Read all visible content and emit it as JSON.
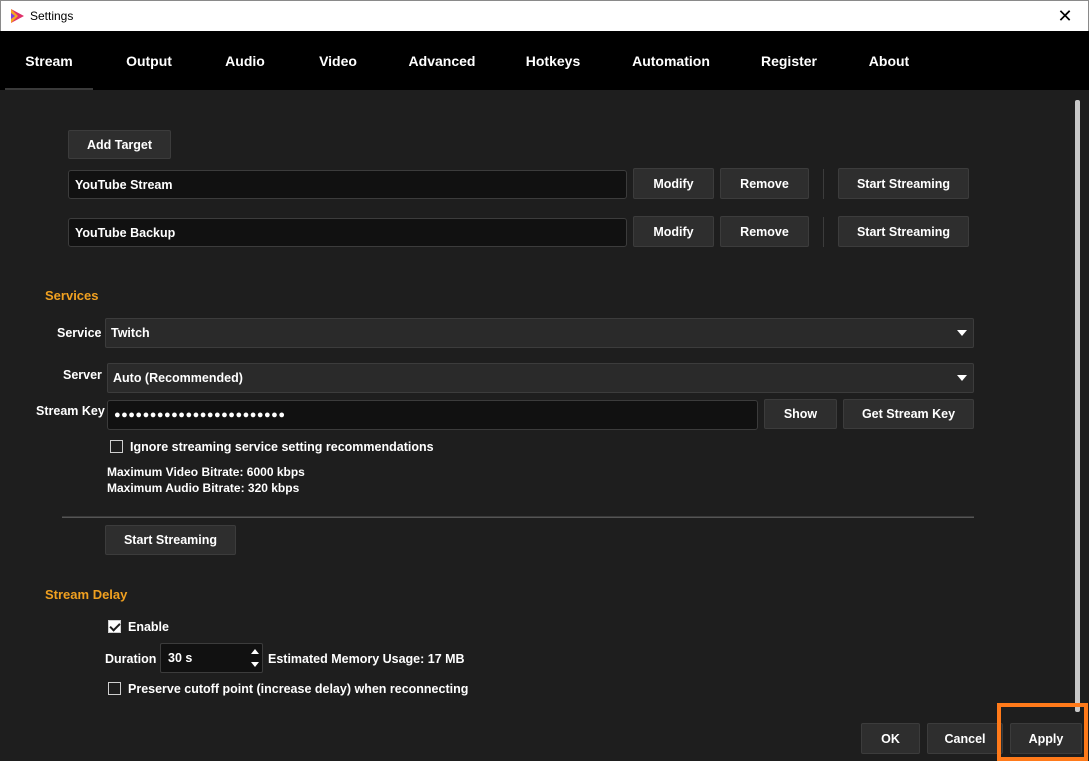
{
  "window": {
    "title": "Settings",
    "icon": "app-logo-icon",
    "close": "✕"
  },
  "tabs": [
    {
      "label": "Stream",
      "active": true
    },
    {
      "label": "Output"
    },
    {
      "label": "Audio"
    },
    {
      "label": "Video"
    },
    {
      "label": "Advanced"
    },
    {
      "label": "Hotkeys"
    },
    {
      "label": "Automation"
    },
    {
      "label": "Register"
    },
    {
      "label": "About"
    }
  ],
  "rtmp": {
    "add_target": "Add Target",
    "targets": [
      {
        "name": "YouTube Stream",
        "modify": "Modify",
        "remove": "Remove",
        "start": "Start Streaming"
      },
      {
        "name": "YouTube Backup",
        "modify": "Modify",
        "remove": "Remove",
        "start": "Start Streaming"
      }
    ]
  },
  "services": {
    "title": "Services",
    "service_label": "Service",
    "service_value": "Twitch",
    "server_label": "Server",
    "server_value": "Auto (Recommended)",
    "key_label": "Stream Key",
    "key_value": "●●●●●●●●●●●●●●●●●●●●●●●●",
    "show": "Show",
    "get_key": "Get Stream Key",
    "ignore_label": "Ignore streaming service setting recommendations",
    "ignore_checked": false,
    "max_video": "Maximum Video Bitrate: 6000 kbps",
    "max_audio": "Maximum Audio Bitrate: 320 kbps",
    "start": "Start Streaming"
  },
  "delay": {
    "title": "Stream Delay",
    "enable_label": "Enable",
    "enable_checked": true,
    "duration_label": "Duration",
    "duration_value": "30 s",
    "memory": "Estimated Memory Usage: 17 MB",
    "preserve_label": "Preserve cutoff point (increase delay) when reconnecting",
    "preserve_checked": false
  },
  "footer": {
    "ok": "OK",
    "cancel": "Cancel",
    "apply": "Apply"
  },
  "colors": {
    "accent": "#f0a020",
    "highlight": "#ff7a1a",
    "background": "#1e1e1e",
    "tabbar": "#000000"
  }
}
